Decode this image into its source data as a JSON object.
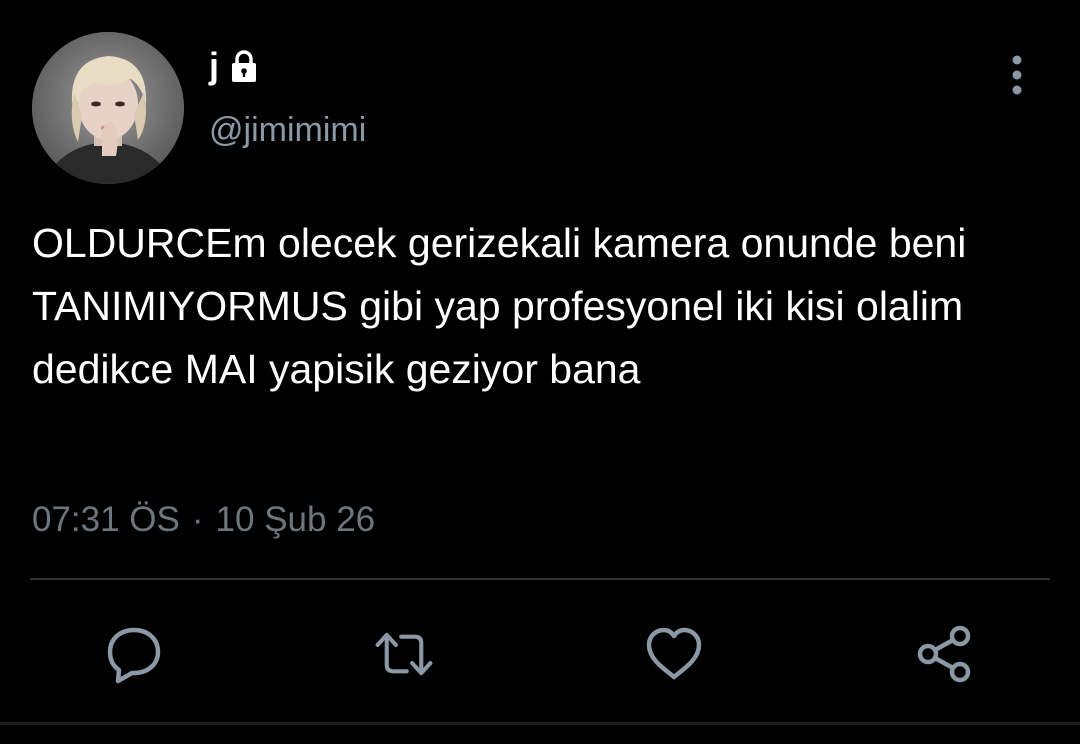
{
  "tweet": {
    "display_name": "j",
    "handle": "@jimimimi",
    "text": "OLDURCEm olecek gerizekali kamera onunde beni TANIMIYORMUS gibi yap profesyonel iki kisi olalim dedikce MAI yapisik geziyor bana",
    "time": "07:31 ÖS",
    "separator": "·",
    "date": "10 Şub 26",
    "protected": true
  },
  "icons": {
    "avatar": "profile-photo",
    "lock": "lock-icon",
    "more": "more-vertical-icon",
    "reply": "reply-icon",
    "retweet": "retweet-icon",
    "like": "heart-icon",
    "share": "share-icon"
  },
  "colors": {
    "background": "#000000",
    "text": "#ffffff",
    "secondary_text": "#8b98a5",
    "icon": "#8b98a5",
    "divider": "#2f3336"
  }
}
